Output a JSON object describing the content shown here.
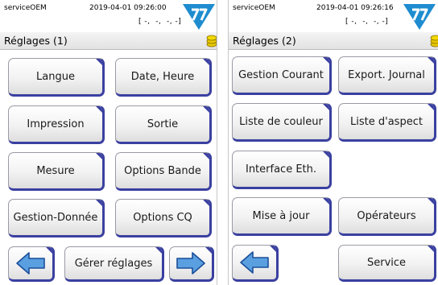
{
  "screen_1": {
    "status": {
      "user": "serviceOEM",
      "datetime": "2019-04-01 09:26:00",
      "coords": "[ -,  -,  -, -]"
    },
    "title": "Réglages (1)",
    "buttons": {
      "language": "Langue",
      "datetime": "Date, Heure",
      "print": "Impression",
      "output": "Sortie",
      "measure": "Mesure",
      "strip_options": "Options Bande",
      "data_management": "Gestion-Donnée",
      "qc_options": "Options CQ",
      "manage_settings": "Gérer réglages"
    }
  },
  "screen_2": {
    "status": {
      "user": "serviceOEM",
      "datetime": "2019-04-01 09:26:16",
      "coords": "[ -,  -,  -, -]"
    },
    "title": "Réglages (2)",
    "buttons": {
      "power_management": "Gestion Courant",
      "export_log": "Export. Journal",
      "color_list": "Liste de couleur",
      "aspect_list": "Liste d'aspect",
      "ethernet_interface": "Interface Eth.",
      "update": "Mise à jour",
      "operators": "Opérateurs",
      "service": "Service"
    }
  },
  "colors": {
    "accent": "#3a40a0",
    "logo_blue": "#1e8ccf",
    "coin": "#e8c800"
  },
  "icons": [
    "logo-icon",
    "coin-stack-icon",
    "arrow-left-icon",
    "arrow-right-icon"
  ]
}
